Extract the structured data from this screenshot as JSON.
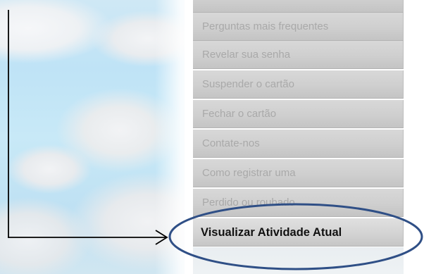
{
  "menu": {
    "items": [
      {
        "label": "Perguntas mais frequentes"
      },
      {
        "label": "Revelar sua senha"
      },
      {
        "label": "Suspender o cartão"
      },
      {
        "label": "Fechar o cartão"
      },
      {
        "label": "Contate-nos"
      },
      {
        "label": "Como registrar uma"
      },
      {
        "label": "Perdido ou roubado"
      },
      {
        "label": "Visualizar Atividade Atual"
      }
    ]
  },
  "colors": {
    "annotation_line": "#000000",
    "highlight_ellipse": "#2f4f86",
    "menu_text_dim": "#a9a9a9",
    "menu_text_active": "#111111"
  }
}
